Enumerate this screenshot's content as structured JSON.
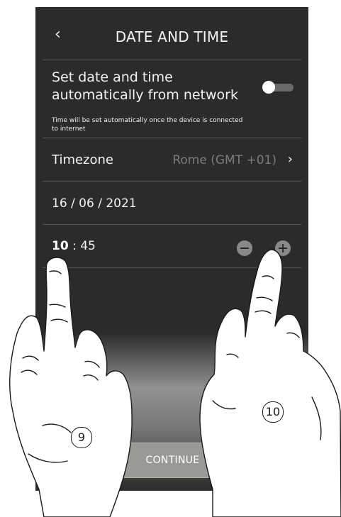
{
  "header": {
    "back_icon": "‹",
    "title": "DATE AND TIME"
  },
  "auto_network": {
    "label": "Set date and time automatically from network",
    "hint": "Time will be set automatically once the device is connected to internet",
    "toggle_on": false
  },
  "timezone": {
    "label": "Timezone",
    "value": "Rome (GMT +01)",
    "chevron": "›"
  },
  "date": {
    "value": "16 / 06 / 2021"
  },
  "time": {
    "hour": "10",
    "separator": " : ",
    "minute": "45"
  },
  "continue_label": "CONTINUE",
  "steps": {
    "left": "9",
    "right": "10"
  },
  "colors": {
    "screen_bg": "#2c2b2a",
    "text": "#f2f2f2",
    "muted": "#7d7c7a",
    "button": "#9a9996"
  }
}
